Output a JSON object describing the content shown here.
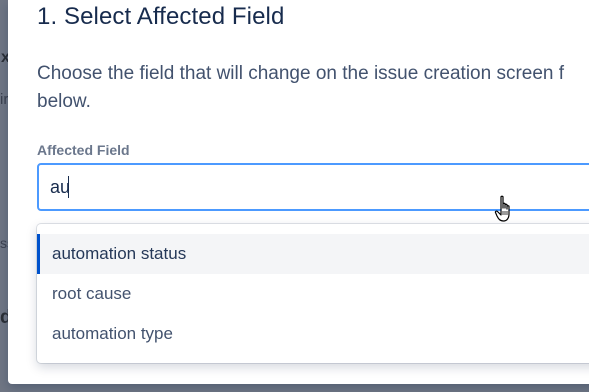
{
  "background": {
    "glyphs": [
      "x",
      "ir",
      "ss",
      "d"
    ]
  },
  "section": {
    "title": "1. Select Affected Field",
    "description_line1": "Choose the field that will change on the issue creation screen f",
    "description_line2": "below."
  },
  "field": {
    "label": "Affected Field",
    "value": "au"
  },
  "dropdown": {
    "options": [
      {
        "label": "automation status",
        "highlighted": true
      },
      {
        "label": "root cause",
        "highlighted": false
      },
      {
        "label": "automation type",
        "highlighted": false
      }
    ]
  },
  "colors": {
    "focus_border": "#4c9aff",
    "highlight_bar": "#0052cc",
    "highlight_bg": "#f4f5f7",
    "title_text": "#172b4d",
    "body_text": "#42526e",
    "label_text": "#6b778c"
  },
  "icons": {
    "pointer": "hand-pointer-icon"
  }
}
